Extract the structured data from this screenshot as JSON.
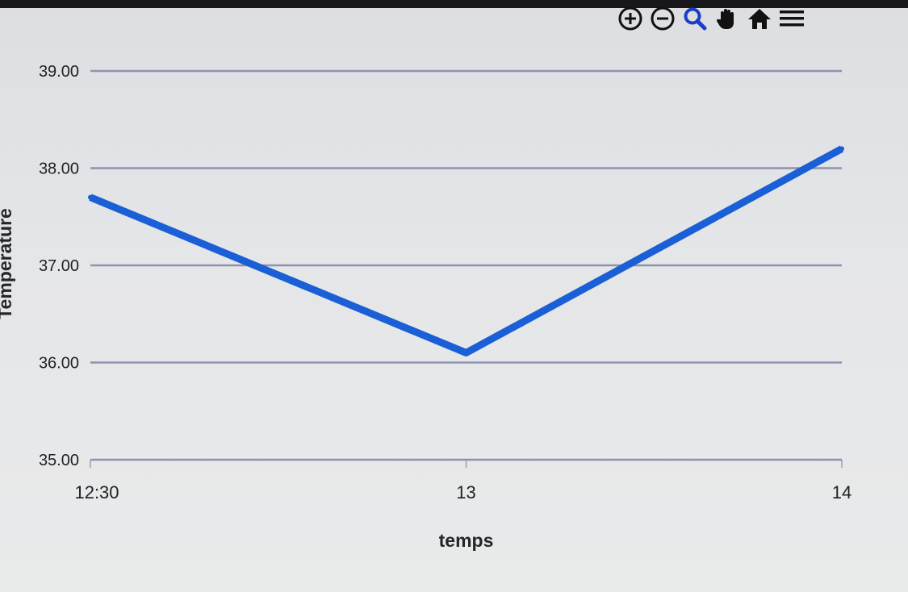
{
  "toolbar": {
    "icons": [
      "zoom-in-icon",
      "zoom-out-icon",
      "search-zoom-icon",
      "pan-hand-icon",
      "home-icon",
      "menu-icon"
    ]
  },
  "chart_data": {
    "type": "line",
    "xlabel": "temps",
    "ylabel": "Temperature",
    "x_ticks": [
      "12:30",
      "13",
      "14"
    ],
    "y_ticks": [
      "35.00",
      "36.00",
      "37.00",
      "38.00",
      "39.00"
    ],
    "ylim": [
      35,
      39
    ],
    "grid": true,
    "series": [
      {
        "x": [
          "12:30",
          "13",
          "14"
        ],
        "values": [
          37.7,
          36.1,
          38.2
        ],
        "color": "#1a5fd6"
      }
    ]
  }
}
